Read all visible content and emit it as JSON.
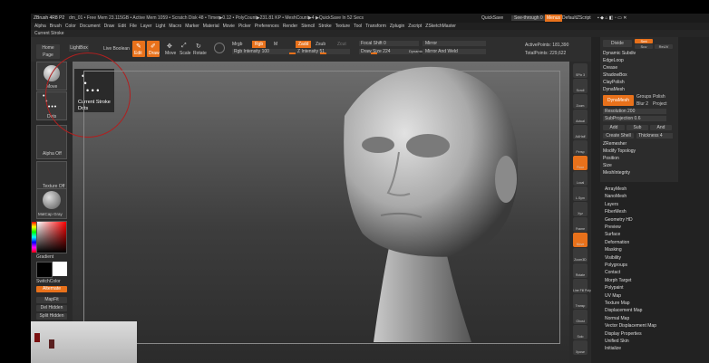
{
  "titlebar": {
    "app": "ZBrush 4R8 P2",
    "info": "dm_01  • Free Mem 23.115GB • Active Mem 1059 • Scratch Disk 48 • Timer▶0.12 • PolyCount▶231.81 KP • MeshCount▶4  ▶QuickSave In 52 Secs",
    "quicksave": "QuickSave",
    "seethrough": "See-through 0",
    "menus_btn": "Menus",
    "script": "DefaultZScript"
  },
  "menubar": {
    "items": [
      "Alpha",
      "Brush",
      "Color",
      "Document",
      "Draw",
      "Edit",
      "File",
      "Layer",
      "Light",
      "Macro",
      "Marker",
      "Material",
      "Movie",
      "Picker",
      "Preferences",
      "Render",
      "Stencil",
      "Stroke",
      "Texture",
      "Tool",
      "Transform",
      "Zplugin",
      "Zscript",
      "ZSketchMaster"
    ]
  },
  "doc_row": {
    "label": "Current Stroke"
  },
  "toolbar": {
    "home": "Home Page",
    "lightbox": "LightBox",
    "live_boolean": "Live Boolean",
    "edit": "Edit",
    "draw": "Draw",
    "move": "Move",
    "scale": "Scale",
    "rotate": "Rotate",
    "mrgb": "Mrgb",
    "rgb": "Rgb",
    "m": "M",
    "zadd": "Zadd",
    "zsub": "Zsub",
    "zcut": "Zcut",
    "rgb_intensity": "Rgb Intensity 100",
    "z_intensity": "Z Intensity 51",
    "focal_shift": "Focal Shift 0",
    "draw_size": "Draw Size 224",
    "dynamic": "Dynamic",
    "mirror": "Mirror",
    "mirror_weld": "Mirror And Weld",
    "rgb_intensity_val": 100,
    "z_intensity_val": 51,
    "draw_size_val": 224
  },
  "stats": {
    "active_points": "ActivePoints: 181,390",
    "total_points": "TotalPoints: 229,622"
  },
  "left_shelf": {
    "brush_label": "Move",
    "stroke_label": "Dots",
    "alpha_label": "Alpha Off",
    "texture_label": "Texture Off",
    "material_label": "MatCap Gray",
    "gradient": "Gradient",
    "switch_color": "SwitchColor",
    "alternate": "Alternate",
    "buttons": [
      "MapFit",
      "Del Hidden",
      "Split Hidden"
    ]
  },
  "stroke_popup": {
    "title": "Current Stroke",
    "name": "Dots"
  },
  "right_shelf": {
    "items": [
      "SPix 3",
      "Scroll",
      "Zoom",
      "Actual",
      "AAHalf",
      "Persp",
      "Floor",
      "Local",
      "L.Sym",
      "Xyz",
      "Frame",
      "Move",
      "Zoom3D",
      "Rotate",
      "Line Fill PolyF",
      "Transp",
      "Ghost",
      "Solo",
      "Xpose"
    ]
  },
  "right_panel": {
    "divide": "Divide",
    "smt": "Smt",
    "suv": "Suv",
    "reuv": "ReUV",
    "items_top": [
      "Dynamic Subdiv",
      "EdgeLoop",
      "Crease",
      "ShadowBox",
      "ClayPolish",
      "DynaMesh"
    ],
    "dynamesh_btn": "DynaMesh",
    "groups": "Groups",
    "polish": "Polish",
    "blur": "Blur",
    "blur_val": "2",
    "project": "Project",
    "resolution": "Resolution 200",
    "subprojection": "SubProjection 0.6",
    "add": "Add",
    "sub": "Sub",
    "and": "And",
    "create_shell": "Create Shell",
    "thickness": "Thickness 4",
    "items_mid": [
      "ZRemesher",
      "Modify Topology",
      "Position",
      "Size",
      "MeshIntegrity"
    ],
    "items_list": [
      "ArrayMesh",
      "NanoMesh",
      "Layers",
      "FiberMesh",
      "Geometry HD",
      "Preview",
      "Surface",
      "Deformation",
      "Masking",
      "Visibility",
      "Polygroups",
      "Contact",
      "Morph Target",
      "Polypaint",
      "UV Map",
      "Texture Map",
      "Displacement Map",
      "Normal Map",
      "Vector Displacement Map",
      "Display Properties",
      "Unified Skin",
      "Initialize"
    ]
  },
  "colors": {
    "accent": "#e8711b",
    "panel": "#2a2a2a"
  }
}
